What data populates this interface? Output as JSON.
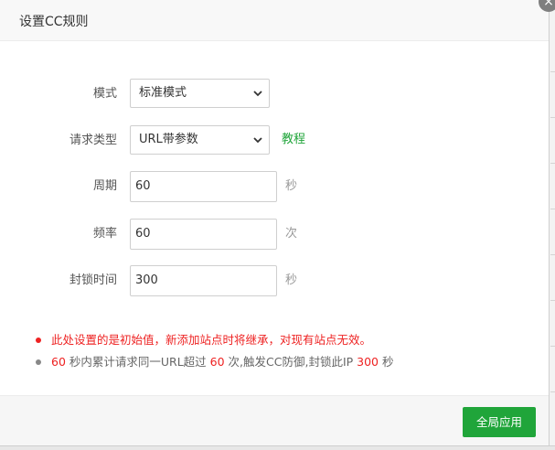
{
  "dialog": {
    "title": "设置CC规则",
    "close_glyph": "×"
  },
  "form": {
    "mode": {
      "label": "模式",
      "value": "标准模式"
    },
    "request_type": {
      "label": "请求类型",
      "value": "URL带参数",
      "link": "教程"
    },
    "cycle": {
      "label": "周期",
      "value": "60",
      "unit": "秒"
    },
    "frequency": {
      "label": "频率",
      "value": "60",
      "unit": "次"
    },
    "ban_time": {
      "label": "封锁时间",
      "value": "300",
      "unit": "秒"
    }
  },
  "notes": {
    "warning": "此处设置的是初始值，新添加站点时将继承，对现有站点无效。",
    "summary": {
      "cycle": "60",
      "t1": " 秒内累计请求同一URL超过 ",
      "freq": "60",
      "t2": " 次,触发CC防御,封锁此IP ",
      "ban": "300",
      "t3": " 秒"
    }
  },
  "footer": {
    "apply_label": "全局应用"
  },
  "colors": {
    "accent": "#20a53a",
    "warning": "#ee2222"
  }
}
